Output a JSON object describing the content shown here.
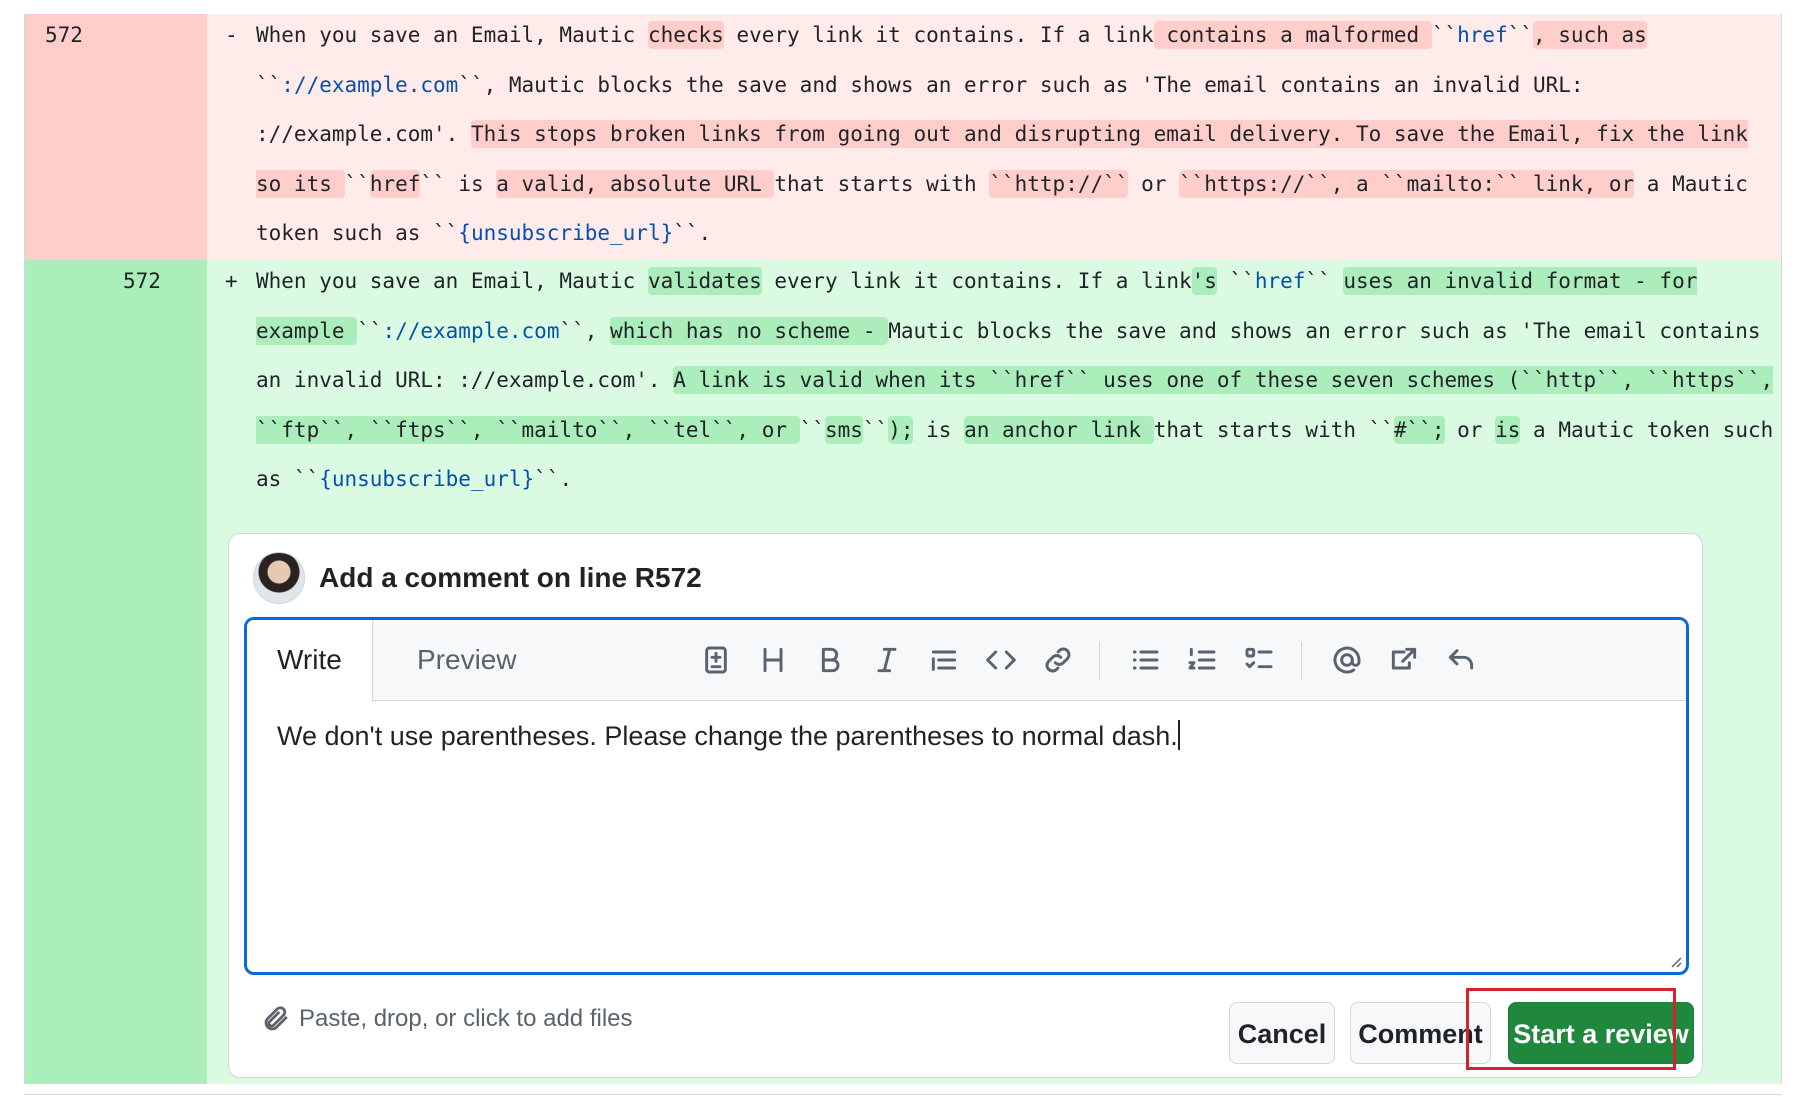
{
  "diff": {
    "deleted": {
      "line_number": "572",
      "sign": "-",
      "segments": [
        {
          "t": "When you save an Email, Mautic ",
          "h": false
        },
        {
          "t": "checks",
          "h": true
        },
        {
          "t": " every link it contains. If a link",
          "h": false
        },
        {
          "t": " contains a malformed ",
          "h": true
        },
        {
          "t": "``",
          "h": false
        },
        {
          "t": "href",
          "h": false,
          "link": true
        },
        {
          "t": "``",
          "h": false
        },
        {
          "t": ", such as",
          "h": true
        },
        {
          "t": " ``",
          "h": false
        },
        {
          "t": "://example.com",
          "h": false,
          "link": true
        },
        {
          "t": "``, Mautic blocks the save and shows an error such as 'The email contains an invalid URL: ://example.com'. ",
          "h": false
        },
        {
          "t": "This stops broken links from going out and disrupting email delivery. To save the Email, fix the link so its ",
          "h": true
        },
        {
          "t": "``",
          "h": false
        },
        {
          "t": "href",
          "h": true
        },
        {
          "t": "`` is ",
          "h": false
        },
        {
          "t": "a valid, absolute URL ",
          "h": true
        },
        {
          "t": "that starts with ",
          "h": false
        },
        {
          "t": "``http://``",
          "h": true
        },
        {
          "t": " or ",
          "h": false
        },
        {
          "t": "``https://``, a ``mailto:`` link, or",
          "h": true
        },
        {
          "t": " a Mautic token such as ``",
          "h": false
        },
        {
          "t": "{unsubscribe_url}",
          "h": false,
          "link": true
        },
        {
          "t": "``.",
          "h": false
        }
      ]
    },
    "added": {
      "line_number": "572",
      "sign": "+",
      "segments": [
        {
          "t": "When you save an Email, Mautic ",
          "h": false
        },
        {
          "t": "validates",
          "h": true
        },
        {
          "t": " every link it contains. If a link",
          "h": false
        },
        {
          "t": "'s",
          "h": true
        },
        {
          "t": " ``",
          "h": false
        },
        {
          "t": "href",
          "h": false,
          "link": true
        },
        {
          "t": "`` ",
          "h": false
        },
        {
          "t": " uses an invalid format - for example ",
          "h": true
        },
        {
          "t": "``",
          "h": false
        },
        {
          "t": "://example.com",
          "h": false,
          "link": true
        },
        {
          "t": "``, ",
          "h": false
        },
        {
          "t": "which has no scheme - ",
          "h": true
        },
        {
          "t": "Mautic blocks the save and shows an error such as 'The email contains an invalid URL: ://example.com'. ",
          "h": false
        },
        {
          "t": "A link is valid when its ``href`` uses one of these seven schemes (``http``, ``https``, ``ftp``, ``ftps``, ``mailto``, ``tel``, or ",
          "h": true
        },
        {
          "t": "``",
          "h": false
        },
        {
          "t": "sms",
          "h": true
        },
        {
          "t": "``",
          "h": false
        },
        {
          "t": ");",
          "h": true
        },
        {
          "t": " is ",
          "h": false
        },
        {
          "t": "an anchor link ",
          "h": true
        },
        {
          "t": "that starts with ``",
          "h": false
        },
        {
          "t": "#``;",
          "h": true
        },
        {
          "t": " or ",
          "h": false
        },
        {
          "t": "is",
          "h": true
        },
        {
          "t": " a Mautic token such as ``",
          "h": false
        },
        {
          "t": "{unsubscribe_url}",
          "h": false,
          "link": true
        },
        {
          "t": "``.",
          "h": false
        }
      ]
    }
  },
  "comment": {
    "title": "Add a comment on line R572",
    "tabs": {
      "write": "Write",
      "preview": "Preview"
    },
    "toolbar_icons": [
      "add-suggestion-icon",
      "heading-icon",
      "bold-icon",
      "italic-icon",
      "quote-icon",
      "code-icon",
      "link-icon",
      "unordered-list-icon",
      "ordered-list-icon",
      "task-list-icon",
      "mention-icon",
      "cross-reference-icon",
      "undo-icon"
    ],
    "body": "We don't use parentheses. Please change the parentheses to normal dash.",
    "attach_hint": "Paste, drop, or click to add files",
    "buttons": {
      "cancel": "Cancel",
      "comment": "Comment",
      "start_review": "Start a review"
    }
  },
  "colors": {
    "primary_button": "#1f883d",
    "focus_border": "#0969da",
    "highlight_box": "#d1242f"
  }
}
